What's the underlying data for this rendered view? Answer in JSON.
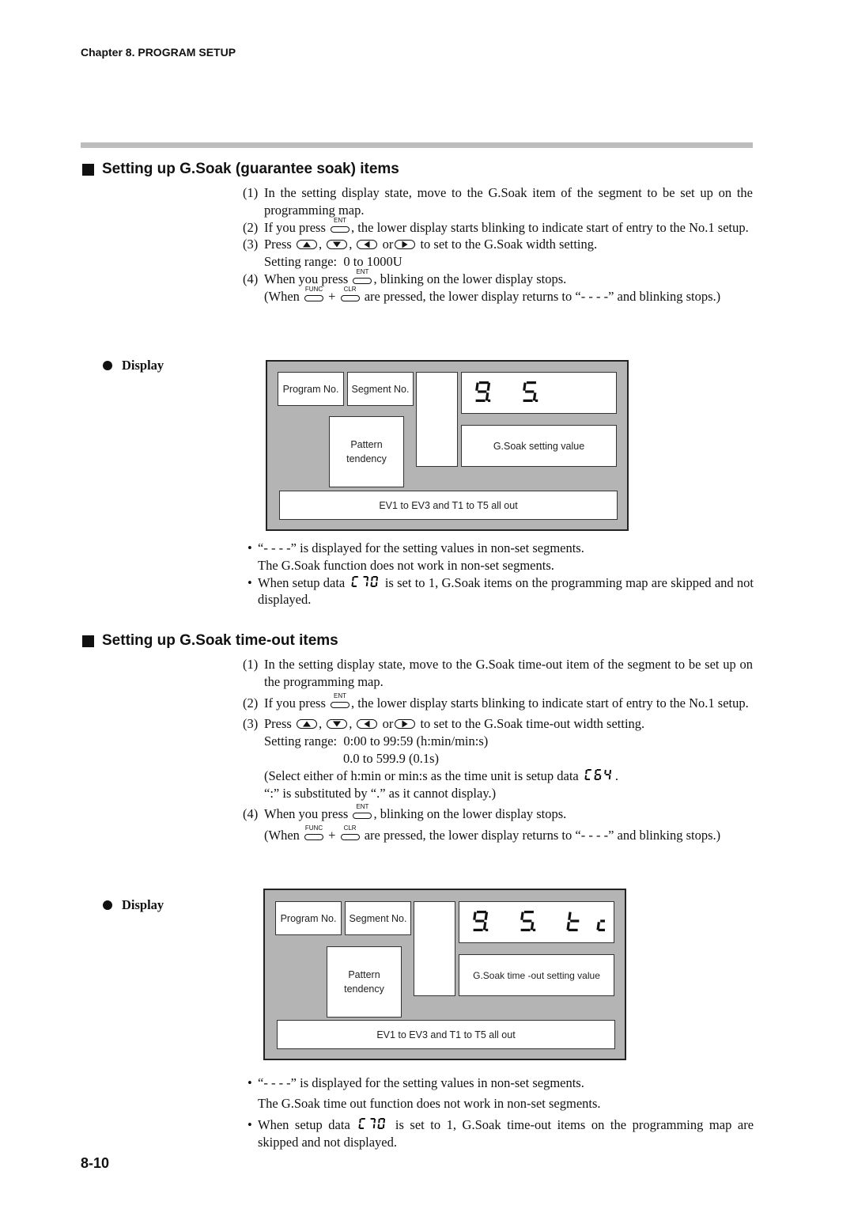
{
  "header": {
    "chapter": "Chapter 8. PROGRAM SETUP"
  },
  "sections": [
    {
      "title": "Setting up G.Soak (guarantee soak) items",
      "steps": [
        {
          "num": "(1)",
          "text": "In the setting display state, move to the G.Soak item of the segment to be set up on the programming map."
        },
        {
          "num": "(2)",
          "pre": "If you press",
          "key": "ENT",
          "post": ", the lower display starts blinking to indicate start of entry to the No.1 setup."
        },
        {
          "num": "(3)",
          "pre": "Press",
          "sep1": ",",
          "sep2": ",",
          "sep3": "or",
          "post": "to set to the G.Soak width setting.",
          "range_label": "Setting range:",
          "range_values": [
            "0 to 1000U"
          ]
        },
        {
          "num": "(4)",
          "pre": "When you press",
          "key": "ENT",
          "post": ", blinking on the lower display stops.",
          "note_pre": "(When",
          "key1": "FUNC",
          "plus": "+",
          "key2": "CLR",
          "note_post": "are pressed, the lower display returns to “- - - -” and blinking stops.)"
        }
      ],
      "display": {
        "label": "Display",
        "program_no": "Program No.",
        "segment_no": "Segment No.",
        "pattern_tendency": "Pattern tendency",
        "upper_display": "G.S.",
        "lower_display": "G.Soak setting value",
        "events": "EV1 to EV3 and T1 to T5 all out"
      },
      "notes": [
        {
          "line1": "“- - - -” is displayed for the setting values in non-set segments.",
          "line2": "The G.Soak function does not work in non-set segments."
        },
        {
          "pre": "When setup data",
          "code": "C70",
          "post": "is set to 1, G.Soak items on the programming map are skipped and not displayed."
        }
      ]
    },
    {
      "title": "Setting up G.Soak time-out items",
      "steps": [
        {
          "num": "(1)",
          "text": "In the setting display state, move to the G.Soak time-out item of the segment to be set up on the programming map."
        },
        {
          "num": "(2)",
          "pre": "If you press",
          "key": "ENT",
          "post": ", the lower display starts blinking to indicate start of entry to the No.1 setup."
        },
        {
          "num": "(3)",
          "pre": "Press",
          "sep1": ",",
          "sep2": ",",
          "sep3": "or",
          "post": "to set to the G.Soak time-out width setting.",
          "range_label": "Setting range:",
          "range_values": [
            "0:00 to 99:59 (h:min/min:s)",
            "0.0 to 599.9 (0.1s)"
          ],
          "extra_pre": "(Select either of h:min or min:s as the time unit is setup data",
          "extra_code": "C64",
          "extra_post": ".",
          "extra2": "“:” is substituted by “.” as it cannot display.)"
        },
        {
          "num": "(4)",
          "pre": "When you press",
          "key": "ENT",
          "post": ", blinking on the lower display stops.",
          "note_pre": "(When",
          "key1": "FUNC",
          "plus": "+",
          "key2": "CLR",
          "note_post": "are pressed, the lower display returns to “- - - -” and blinking stops.)"
        }
      ],
      "display": {
        "label": "Display",
        "program_no": "Program No.",
        "segment_no": "Segment No.",
        "pattern_tendency": "Pattern tendency",
        "upper_display": "G.S.to",
        "lower_display": "G.Soak time -out setting value",
        "events": "EV1 to EV3 and T1 to T5 all out"
      },
      "notes": [
        {
          "line1": "“- - - -” is displayed for the setting values in non-set segments.",
          "line2": "The G.Soak time out function does not work in non-set segments."
        },
        {
          "pre": "When setup data",
          "code": "C70",
          "post": "is set to 1, G.Soak time-out items on the programming map are skipped and not displayed."
        }
      ]
    }
  ],
  "footer": {
    "page_number": "8-10"
  },
  "icons": {
    "key_up": "up-arrow-key-icon",
    "key_down": "down-arrow-key-icon",
    "key_left": "left-arrow-key-icon",
    "key_right": "right-arrow-key-icon",
    "bullet_square": "black-square-icon",
    "bullet_circle": "black-circle-icon"
  }
}
